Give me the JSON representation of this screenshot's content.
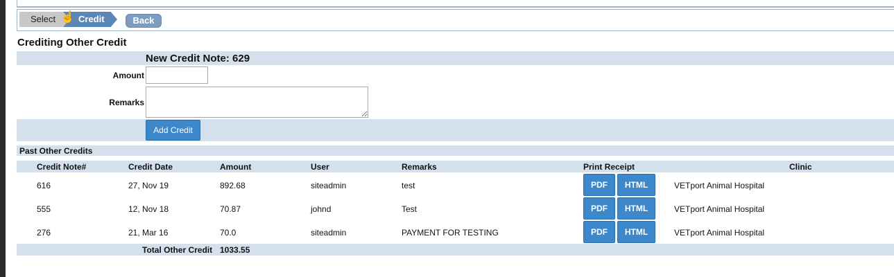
{
  "wizard": {
    "step_select": "Select",
    "step_credit": "Credit",
    "back_label": "Back"
  },
  "page_title": "Crediting Other Credit",
  "form": {
    "note_title": "New Credit Note: 629",
    "amount_label": "Amount",
    "amount_value": "",
    "remarks_label": "Remarks",
    "remarks_value": "",
    "add_button": "Add Credit"
  },
  "past": {
    "section_label": "Past Other Credits",
    "columns": [
      "Credit Note#",
      "Credit Date",
      "Amount",
      "User",
      "Remarks",
      "Print Receipt",
      "Clinic"
    ],
    "rows": [
      {
        "note": "616",
        "date": "27, Nov 19",
        "amount": "892.68",
        "user": "siteadmin",
        "remarks": "test",
        "pdf": "PDF",
        "html": "HTML",
        "clinic": "VETport Animal Hospital"
      },
      {
        "note": "555",
        "date": "12, Nov 18",
        "amount": "70.87",
        "user": "johnd",
        "remarks": "Test",
        "pdf": "PDF",
        "html": "HTML",
        "clinic": "VETport Animal Hospital"
      },
      {
        "note": "276",
        "date": "21, Mar 16",
        "amount": "70.0",
        "user": "siteadmin",
        "remarks": "PAYMENT FOR TESTING",
        "pdf": "PDF",
        "html": "HTML",
        "clinic": "VETport Animal Hospital"
      }
    ],
    "total_label": "Total Other Credit",
    "total_value": "1033.55"
  },
  "colors": {
    "band": "#d4e1ed",
    "button": "#3d87cb",
    "wizard_active": "#5b87b6"
  }
}
